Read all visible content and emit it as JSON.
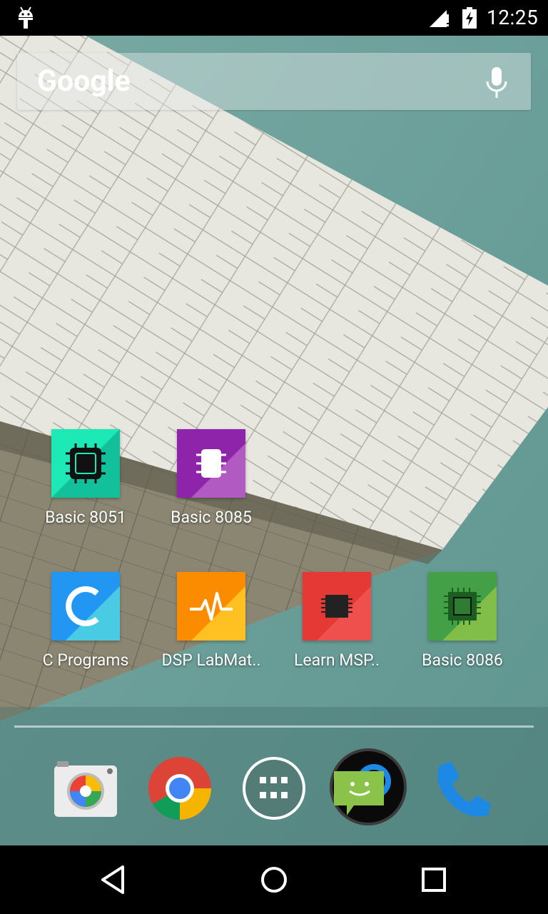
{
  "status_bar": {
    "time": "12:25",
    "icons": [
      "android-debug-icon",
      "signal-icon",
      "battery-charging-icon"
    ]
  },
  "search": {
    "logo_text": "Google",
    "icons": [
      "mic-icon"
    ]
  },
  "apps": [
    {
      "label": "Basic 8051",
      "icon": "chip-icon",
      "color": "#1de9b6"
    },
    {
      "label": "Basic 8085",
      "icon": "ic-chip-icon",
      "color": "#8e24aa"
    },
    {
      "label": "C Programs",
      "icon": "letter-c-icon",
      "color": "#2196f3"
    },
    {
      "label": "DSP LabMat..",
      "icon": "waveform-icon",
      "color": "#fb8c00"
    },
    {
      "label": "Learn MSP..",
      "icon": "chip-icon",
      "color": "#e53935"
    },
    {
      "label": "Basic 8086",
      "icon": "chip-icon",
      "color": "#43a047"
    }
  ],
  "dock": [
    {
      "name": "camera",
      "icon": "camera-icon"
    },
    {
      "name": "chrome",
      "icon": "chrome-icon"
    },
    {
      "name": "app-drawer",
      "icon": "app-drawer-icon"
    },
    {
      "name": "messenger",
      "icon": "messenger-icon"
    },
    {
      "name": "phone",
      "icon": "phone-icon"
    }
  ],
  "nav": {
    "icons": [
      "back-icon",
      "home-icon",
      "recents-icon"
    ]
  },
  "colors": {
    "wallpaper_teal": "#6a9d98",
    "status_bar": "#000000"
  }
}
